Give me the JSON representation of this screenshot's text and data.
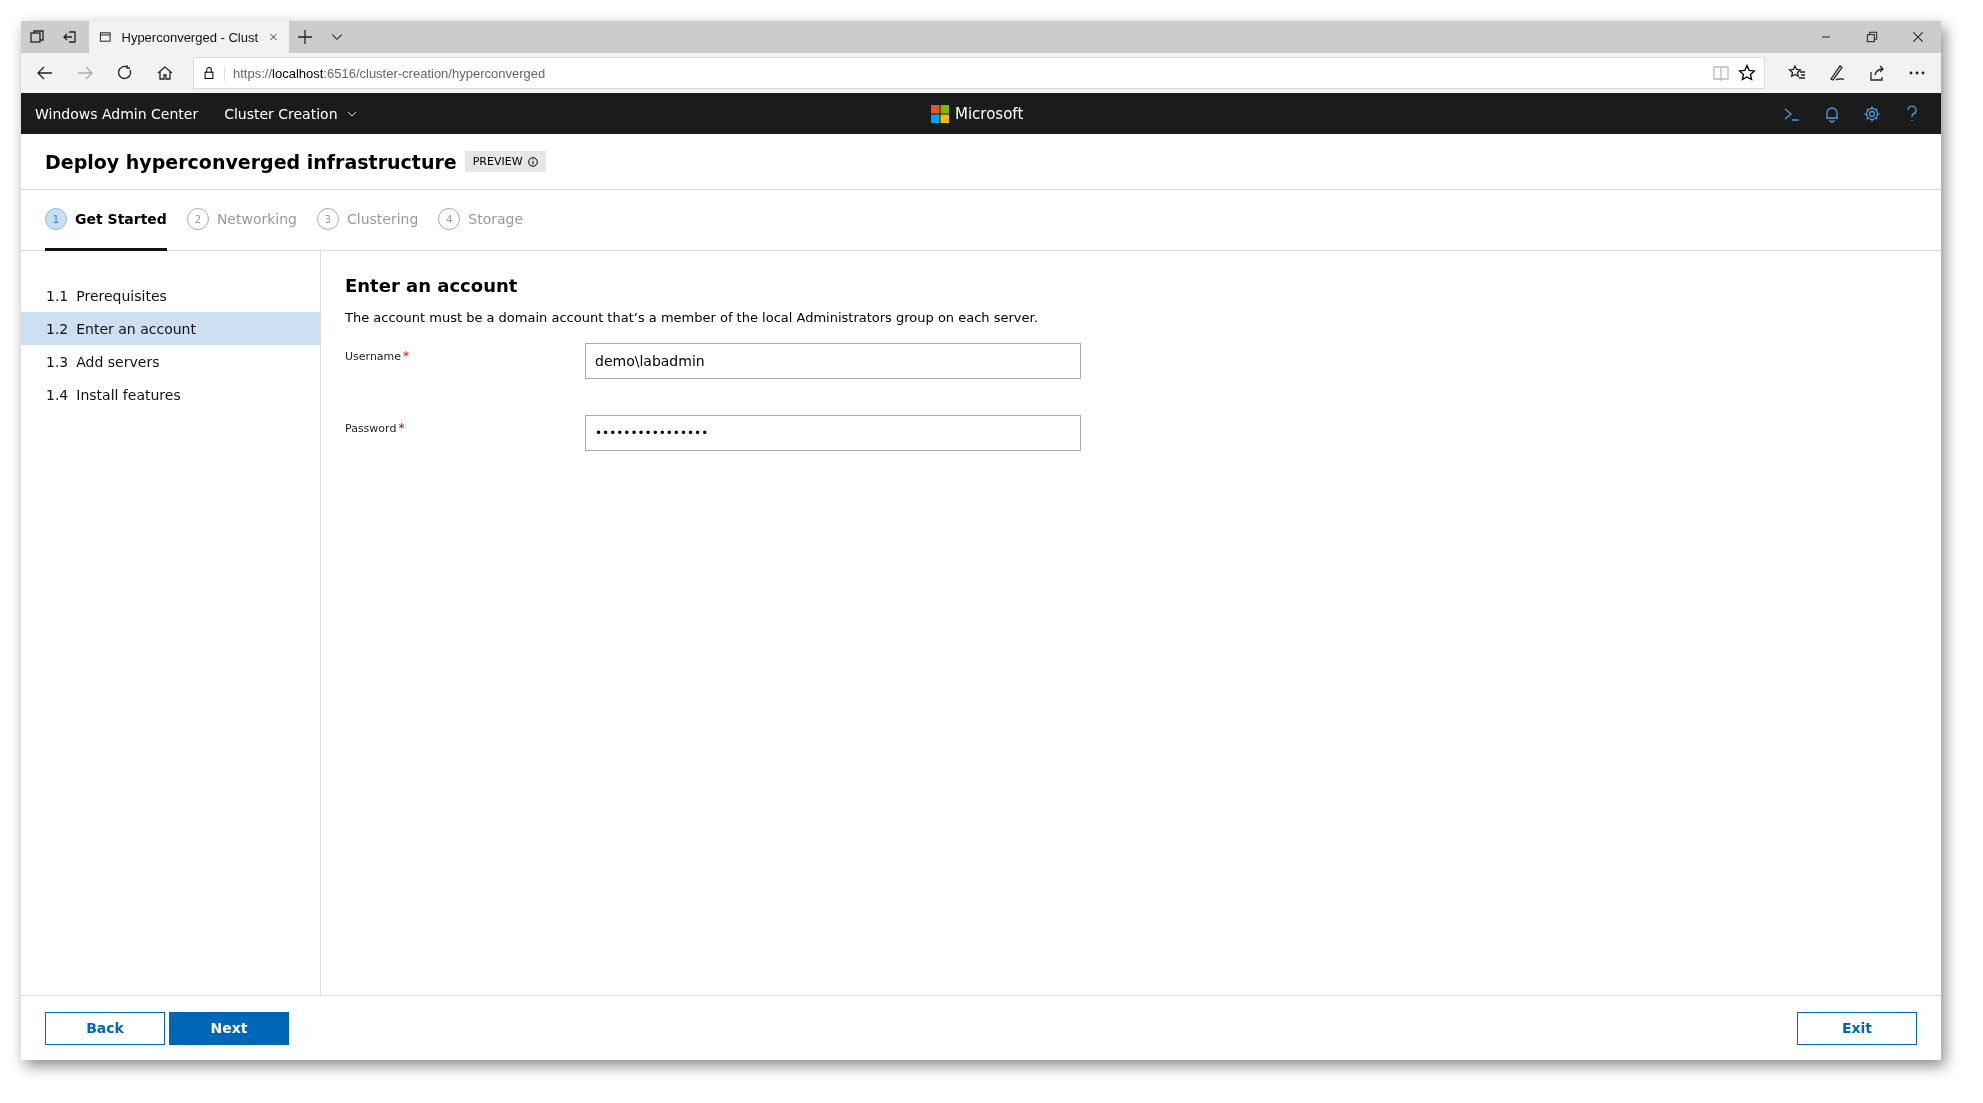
{
  "browser": {
    "tab_title": "Hyperconverged - Clust",
    "url_prefix": "https://",
    "url_host": "localhost",
    "url_path": ":6516/cluster-creation/hyperconverged"
  },
  "app_header": {
    "product": "Windows Admin Center",
    "context": "Cluster Creation",
    "brand": "Microsoft"
  },
  "page": {
    "title": "Deploy hyperconverged infrastructure",
    "badge": "PREVIEW"
  },
  "steps": [
    {
      "number": "1",
      "label": "Get Started",
      "selected": true
    },
    {
      "number": "2",
      "label": "Networking",
      "selected": false
    },
    {
      "number": "3",
      "label": "Clustering",
      "selected": false
    },
    {
      "number": "4",
      "label": "Storage",
      "selected": false
    }
  ],
  "sidebar": {
    "items": [
      {
        "number": "1.1",
        "label": "Prerequisites",
        "selected": false
      },
      {
        "number": "1.2",
        "label": "Enter an account",
        "selected": true
      },
      {
        "number": "1.3",
        "label": "Add servers",
        "selected": false
      },
      {
        "number": "1.4",
        "label": "Install features",
        "selected": false
      }
    ]
  },
  "form": {
    "heading": "Enter an account",
    "description": "The account must be a domain account that’s a member of the local Administrators group on each server.",
    "fields": [
      {
        "label": "Username",
        "marker": "*",
        "value": "demo\\labadmin",
        "kind": "text"
      },
      {
        "label": "Password",
        "marker": "*",
        "value": "••••••••••••••••",
        "kind": "password"
      }
    ]
  },
  "footer": {
    "back": "Back",
    "next": "Next",
    "exit": "Exit"
  }
}
